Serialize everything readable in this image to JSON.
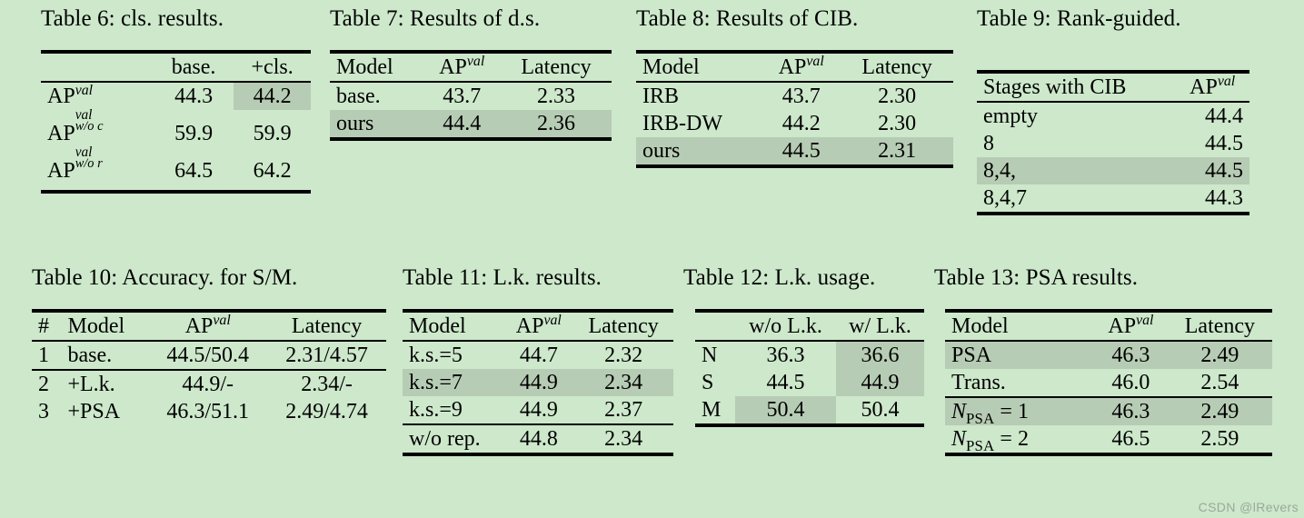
{
  "page": {
    "background_color": "#cde8cb",
    "highlight_color": "#b7ccb4",
    "watermark": "CSDN @lRevers"
  },
  "tables": {
    "t6": {
      "caption": "Table 6: cls. results.",
      "headers": [
        "",
        "base.",
        "+cls."
      ],
      "rows": [
        {
          "label_base": "AP",
          "label_sup": "val",
          "label_sub": "",
          "values": [
            "44.3",
            "44.2"
          ],
          "highlight_cells": [
            1
          ]
        },
        {
          "label_base": "AP",
          "label_sup": "val",
          "label_sub": "w/o c",
          "values": [
            "59.9",
            "59.9"
          ],
          "highlight_cells": []
        },
        {
          "label_base": "AP",
          "label_sup": "val",
          "label_sub": "w/o r",
          "values": [
            "64.5",
            "64.2"
          ],
          "highlight_cells": []
        }
      ]
    },
    "t7": {
      "caption": "Table 7: Results of d.s.",
      "headers": [
        "Model",
        "AP",
        "Latency"
      ],
      "header_sup": "val",
      "rows": [
        {
          "label": "base.",
          "values": [
            "43.7",
            "2.33"
          ],
          "highlight": false
        },
        {
          "label": "ours",
          "values": [
            "44.4",
            "2.36"
          ],
          "highlight": true
        }
      ]
    },
    "t8": {
      "caption": "Table 8: Results of CIB.",
      "headers": [
        "Model",
        "AP",
        "Latency"
      ],
      "header_sup": "val",
      "rows": [
        {
          "label": "IRB",
          "values": [
            "43.7",
            "2.30"
          ],
          "highlight": false
        },
        {
          "label": "IRB-DW",
          "values": [
            "44.2",
            "2.30"
          ],
          "highlight": false
        },
        {
          "label": "ours",
          "values": [
            "44.5",
            "2.31"
          ],
          "highlight": true
        }
      ]
    },
    "t9": {
      "caption": "Table 9: Rank-guided.",
      "headers": [
        "Stages with CIB",
        "AP"
      ],
      "header_sup": "val",
      "rows": [
        {
          "label": "empty",
          "values": [
            "44.4"
          ],
          "highlight": false
        },
        {
          "label": "8",
          "values": [
            "44.5"
          ],
          "highlight": false
        },
        {
          "label": "8,4,",
          "values": [
            "44.5"
          ],
          "highlight": true
        },
        {
          "label": "8,4,7",
          "values": [
            "44.3"
          ],
          "highlight": false
        }
      ]
    },
    "t10": {
      "caption": "Table 10: Accuracy. for S/M.",
      "headers": [
        "#",
        "Model",
        "AP",
        "Latency"
      ],
      "header_sup": "val",
      "rows": [
        {
          "num": "1",
          "label": "base.",
          "values": [
            "44.5/50.4",
            "2.31/4.57"
          ],
          "rule_after": true
        },
        {
          "num": "2",
          "label": "+L.k.",
          "values": [
            "44.9/-",
            "2.34/-"
          ],
          "rule_after": false
        },
        {
          "num": "3",
          "label": "+PSA",
          "values": [
            "46.3/51.1",
            "2.49/4.74"
          ],
          "rule_after": false
        }
      ]
    },
    "t11": {
      "caption": "Table 11: L.k. results.",
      "headers": [
        "Model",
        "AP",
        "Latency"
      ],
      "header_sup": "val",
      "rows": [
        {
          "label": "k.s.=5",
          "values": [
            "44.7",
            "2.32"
          ],
          "highlight": false,
          "rule_before": false
        },
        {
          "label": "k.s.=7",
          "values": [
            "44.9",
            "2.34"
          ],
          "highlight": true,
          "rule_before": false
        },
        {
          "label": "k.s.=9",
          "values": [
            "44.9",
            "2.37"
          ],
          "highlight": false,
          "rule_before": false
        },
        {
          "label": "w/o rep.",
          "values": [
            "44.8",
            "2.34"
          ],
          "highlight": false,
          "rule_before": true
        }
      ]
    },
    "t12": {
      "caption": "Table 12: L.k. usage.",
      "headers": [
        "",
        "w/o L.k.",
        "w/ L.k."
      ],
      "rows": [
        {
          "label": "N",
          "values": [
            "36.3",
            "36.6"
          ],
          "highlight_cells": [
            1
          ]
        },
        {
          "label": "S",
          "values": [
            "44.5",
            "44.9"
          ],
          "highlight_cells": [
            1
          ]
        },
        {
          "label": "M",
          "values": [
            "50.4",
            "50.4"
          ],
          "highlight_cells": [
            0
          ]
        }
      ]
    },
    "t13": {
      "caption": "Table 13: PSA results.",
      "headers": [
        "Model",
        "AP",
        "Latency"
      ],
      "header_sup": "val",
      "rows": [
        {
          "label_plain": "PSA",
          "label_var": "",
          "label_suffix": "",
          "values": [
            "46.3",
            "2.49"
          ],
          "highlight": true,
          "rule_before": false
        },
        {
          "label_plain": "Trans.",
          "label_var": "",
          "label_suffix": "",
          "values": [
            "46.0",
            "2.54"
          ],
          "highlight": false,
          "rule_before": false
        },
        {
          "label_plain": "",
          "label_var": "N",
          "label_sub": "PSA",
          "label_suffix": " = 1",
          "values": [
            "46.3",
            "2.49"
          ],
          "highlight": true,
          "rule_before": true
        },
        {
          "label_plain": "",
          "label_var": "N",
          "label_sub": "PSA",
          "label_suffix": " = 2",
          "values": [
            "46.5",
            "2.59"
          ],
          "highlight": false,
          "rule_before": false
        }
      ]
    }
  }
}
